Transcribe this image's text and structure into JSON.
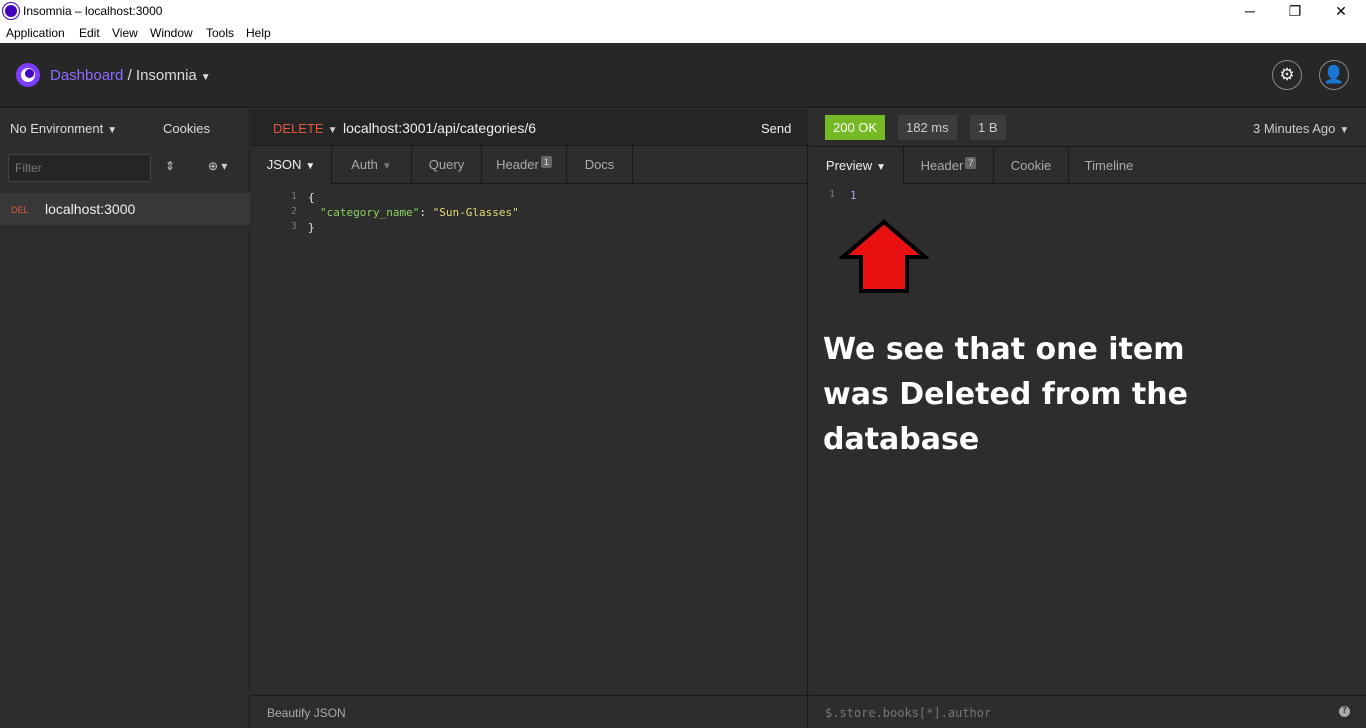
{
  "window": {
    "title": "Insomnia – localhost:3000",
    "min": "─",
    "max": "❐",
    "close": "✕"
  },
  "menu": [
    "Application",
    "Edit",
    "View",
    "Window",
    "Tools",
    "Help"
  ],
  "header": {
    "dashboard": "Dashboard",
    "separator": "/",
    "workspace": "Insomnia"
  },
  "sidebar": {
    "environment": "No Environment",
    "cookies": "Cookies",
    "filter_placeholder": "Filter",
    "items": [
      {
        "method": "DEL",
        "name": "localhost:3000"
      }
    ]
  },
  "request": {
    "method": "DELETE",
    "url": "localhost:3001/api/categories/6",
    "send": "Send",
    "tabs": [
      {
        "label": "JSON"
      },
      {
        "label": "Auth"
      },
      {
        "label": "Query"
      },
      {
        "label": "Header",
        "badge": "1"
      },
      {
        "label": "Docs"
      }
    ],
    "body_lines": [
      {
        "n": "1",
        "text": "{"
      },
      {
        "n": "2",
        "key": "\"category_name\"",
        "sep": ": ",
        "val": "\"Sun-Glasses\""
      },
      {
        "n": "3",
        "text": "}"
      }
    ],
    "footer": "Beautify JSON"
  },
  "response": {
    "status": "200 OK",
    "time": "182 ms",
    "size": "1 B",
    "ago": "3 Minutes Ago",
    "tabs": [
      {
        "label": "Preview"
      },
      {
        "label": "Header",
        "badge": "7"
      },
      {
        "label": "Cookie"
      },
      {
        "label": "Timeline"
      }
    ],
    "line_no": "1",
    "line_val": "1",
    "filter_placeholder": "$.store.books[*].author",
    "annotation": "We see that one item was Deleted from the database"
  },
  "colors": {
    "accent": "#8d6bff",
    "delete": "#e0593d",
    "ok": "#75ba24",
    "arrow": "#ff0000"
  }
}
